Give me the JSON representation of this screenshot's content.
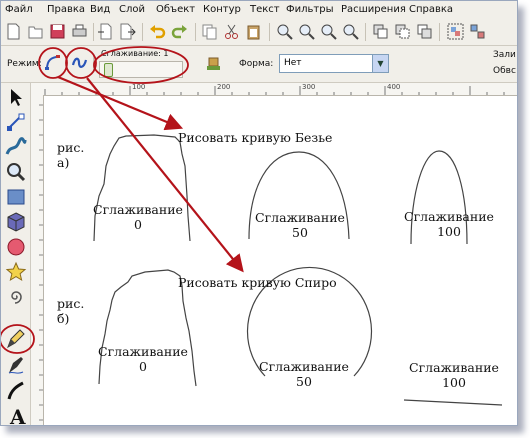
{
  "menu": [
    "Файл",
    "Правка",
    "Вид",
    "Слой",
    "Объект",
    "Контур",
    "Текст",
    "Фильтры",
    "Расширения",
    "Справка"
  ],
  "tool_controls": {
    "mode_label": "Режим:",
    "smoothing_label": "Сглаживание: 1",
    "smoothing_value": 1,
    "shape_label": "Форма:",
    "shape_value": "Нет",
    "right_labels": [
      "Зали",
      "Обвс"
    ]
  },
  "ruler": {
    "h_ticks": [
      "100",
      "200",
      "300",
      "400"
    ]
  },
  "canvas": {
    "row_a_label": "рис.\nа)",
    "row_b_label": "рис.\nб)",
    "bezier_title": "Рисовать кривую Безье",
    "spiro_title": "Рисовать кривую Спиро",
    "smoothing_word": "Сглаживание",
    "values": [
      "0",
      "50",
      "100"
    ]
  },
  "icons": {
    "toolbar": [
      "new-doc-icon",
      "open-icon",
      "save-icon",
      "print-icon",
      "import-icon",
      "export-icon",
      "undo-icon",
      "redo-icon",
      "copy-icon",
      "cut-icon",
      "paste-icon",
      "zoom-selection-icon",
      "zoom-drawing-icon",
      "zoom-page-icon",
      "duplicate-icon",
      "clone-icon",
      "unlink-clone-icon",
      "group-icon",
      "ungroup-icon"
    ],
    "tools": [
      "selector-icon",
      "node-icon",
      "tweak-icon",
      "zoom-icon",
      "rect-icon",
      "3dbox-icon",
      "ellipse-icon",
      "star-icon",
      "spiral-icon",
      "pencil-icon",
      "pen-icon",
      "calligraphy-icon",
      "text-icon"
    ]
  },
  "colors": {
    "annotation_red": "#b4131a",
    "ui_bg": "#f1efe9"
  }
}
